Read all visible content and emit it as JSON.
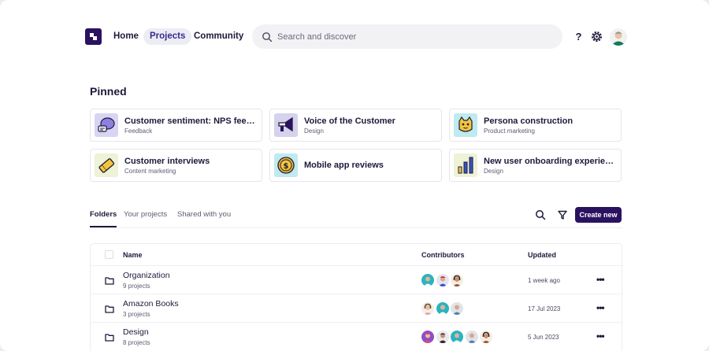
{
  "nav": {
    "links": [
      "Home",
      "Projects",
      "Community"
    ],
    "active": "Projects",
    "search_placeholder": "Search and discover",
    "help_label": "?"
  },
  "pinned": {
    "title": "Pinned",
    "cards": [
      {
        "title": "Customer sentiment: NPS feedb...",
        "subtitle": "Feedback",
        "icon": "speech-bubble-icon"
      },
      {
        "title": "Voice of the Customer",
        "subtitle": "Design",
        "icon": "megaphone-icon"
      },
      {
        "title": "Persona construction",
        "subtitle": "Product marketing",
        "icon": "persona-cat-icon"
      },
      {
        "title": "Customer interviews",
        "subtitle": "Content marketing",
        "icon": "ticket-icon"
      },
      {
        "title": "Mobile app reviews",
        "subtitle": "",
        "icon": "coin-icon"
      },
      {
        "title": "New user onboarding experience",
        "subtitle": "Design",
        "icon": "bar-chart-icon"
      }
    ]
  },
  "tabs": {
    "items": [
      "Folders",
      "Your projects",
      "Shared with you"
    ],
    "active": "Folders",
    "create_label": "Create new"
  },
  "table": {
    "headers": {
      "name": "Name",
      "contributors": "Contributors",
      "updated": "Updated"
    },
    "rows": [
      {
        "name": "Organization",
        "sub": "9 projects",
        "updated": "1 week ago",
        "contributors": 3
      },
      {
        "name": "Amazon Books",
        "sub": "3 projects",
        "updated": "17 Jul 2023",
        "contributors": 3
      },
      {
        "name": "Design",
        "sub": "8 projects",
        "updated": "5 Jun 2023",
        "contributors": 5
      }
    ],
    "more_label": "•••"
  },
  "colors": {
    "brand": "#2a1260",
    "accent_teal": "#2bb3c0",
    "text": "#1c1a3a"
  }
}
